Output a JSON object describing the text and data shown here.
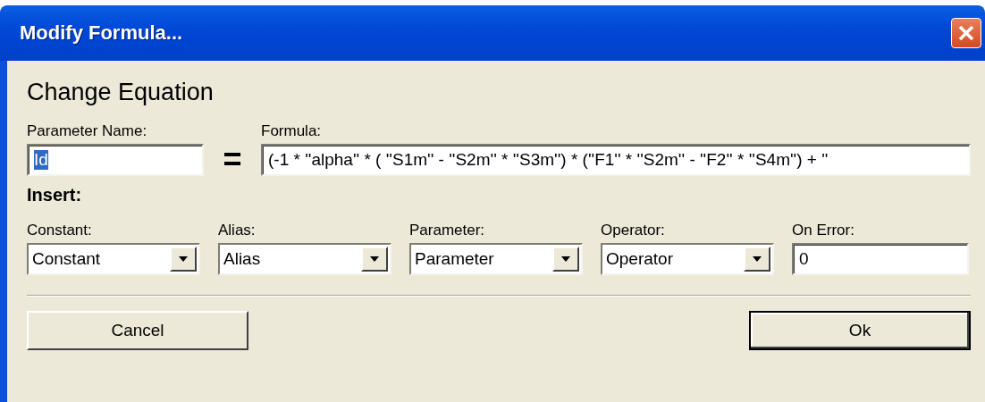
{
  "window": {
    "title": "Modify Formula..."
  },
  "heading": "Change Equation",
  "parameter_name": {
    "label": "Parameter Name:",
    "value": "Id",
    "value_selected": true
  },
  "equals": "=",
  "formula": {
    "label": "Formula:",
    "value": "(-1 * ''alpha'' * ( ''S1m'' -  ''S2m'' *  ''S3m'') * (''F1'' *  ''S2m'' -  ''F2'' *  ''S4m'') +  ''"
  },
  "insert": {
    "title": "Insert:",
    "fields": [
      {
        "kind": "dropdown",
        "label": "Constant:",
        "value": "Constant"
      },
      {
        "kind": "dropdown",
        "label": "Alias:",
        "value": "Alias"
      },
      {
        "kind": "dropdown",
        "label": "Parameter:",
        "value": "Parameter"
      },
      {
        "kind": "dropdown",
        "label": "Operator:",
        "value": "Operator"
      },
      {
        "kind": "text",
        "label": "On Error:",
        "value": "0"
      }
    ]
  },
  "buttons": [
    {
      "label": "Cancel",
      "default": false
    },
    {
      "label": "Ok",
      "default": true
    }
  ]
}
